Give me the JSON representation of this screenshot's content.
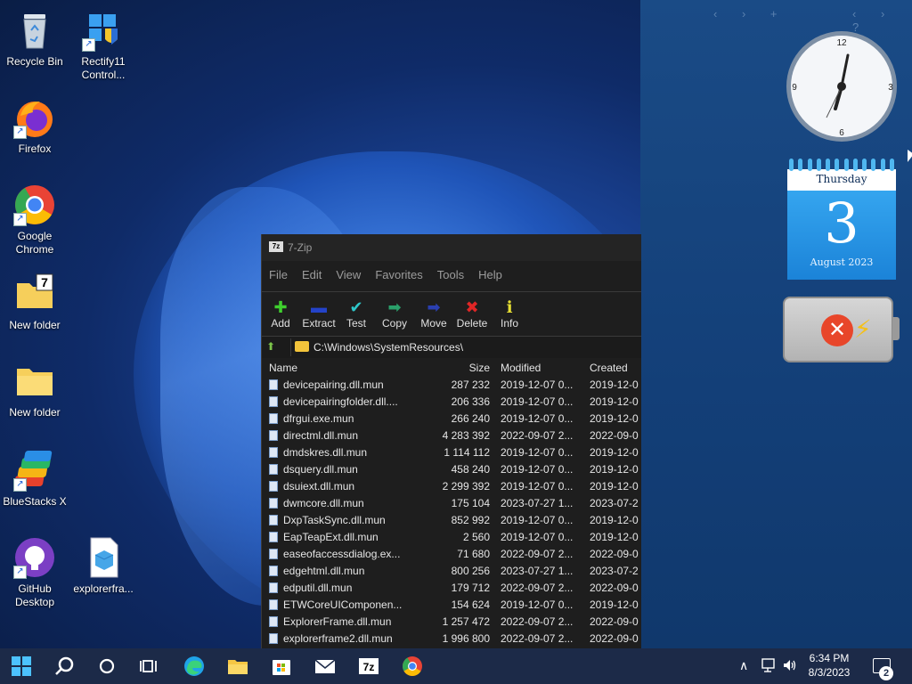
{
  "desktop": {
    "icons": [
      {
        "label": "Recycle Bin"
      },
      {
        "label": "Rectify11 Control..."
      },
      {
        "label": "Firefox"
      },
      {
        "label": "Google Chrome"
      },
      {
        "label": "New folder"
      },
      {
        "label": "New folder"
      },
      {
        "label": "BlueStacks X"
      },
      {
        "label": "GitHub Desktop"
      },
      {
        "label": "explorerfra..."
      }
    ]
  },
  "widgets": {
    "clock": {
      "n12": "12",
      "n3": "3",
      "n6": "6",
      "n9": "9"
    },
    "calendar": {
      "weekday": "Thursday",
      "day": "3",
      "month_year": "August 2023"
    }
  },
  "zip_window": {
    "title": "7-Zip",
    "menu": [
      "File",
      "Edit",
      "View",
      "Favorites",
      "Tools",
      "Help"
    ],
    "toolbar": [
      {
        "label": "Add",
        "icon": "plus-icon",
        "color": "#3fcf2e"
      },
      {
        "label": "Extract",
        "icon": "minus-icon",
        "color": "#2443c9"
      },
      {
        "label": "Test",
        "icon": "check-icon",
        "color": "#2ec6c9"
      },
      {
        "label": "Copy",
        "icon": "copy-arrow-icon",
        "color": "#2aa06a"
      },
      {
        "label": "Move",
        "icon": "move-arrow-icon",
        "color": "#2a3fb0"
      },
      {
        "label": "Delete",
        "icon": "delete-x-icon",
        "color": "#e02626"
      },
      {
        "label": "Info",
        "icon": "info-icon",
        "color": "#e8e033"
      }
    ],
    "path": "C:\\Windows\\SystemResources\\",
    "columns": {
      "name": "Name",
      "size": "Size",
      "modified": "Modified",
      "created": "Created"
    },
    "files": [
      {
        "name": "devicepairing.dll.mun",
        "size": "287 232",
        "modified": "2019-12-07 0...",
        "created": "2019-12-0"
      },
      {
        "name": "devicepairingfolder.dll....",
        "size": "206 336",
        "modified": "2019-12-07 0...",
        "created": "2019-12-0"
      },
      {
        "name": "dfrgui.exe.mun",
        "size": "266 240",
        "modified": "2019-12-07 0...",
        "created": "2019-12-0"
      },
      {
        "name": "directml.dll.mun",
        "size": "4 283 392",
        "modified": "2022-09-07 2...",
        "created": "2022-09-0"
      },
      {
        "name": "dmdskres.dll.mun",
        "size": "1 114 112",
        "modified": "2019-12-07 0...",
        "created": "2019-12-0"
      },
      {
        "name": "dsquery.dll.mun",
        "size": "458 240",
        "modified": "2019-12-07 0...",
        "created": "2019-12-0"
      },
      {
        "name": "dsuiext.dll.mun",
        "size": "2 299 392",
        "modified": "2019-12-07 0...",
        "created": "2019-12-0"
      },
      {
        "name": "dwmcore.dll.mun",
        "size": "175 104",
        "modified": "2023-07-27 1...",
        "created": "2023-07-2"
      },
      {
        "name": "DxpTaskSync.dll.mun",
        "size": "852 992",
        "modified": "2019-12-07 0...",
        "created": "2019-12-0"
      },
      {
        "name": "EapTeapExt.dll.mun",
        "size": "2 560",
        "modified": "2019-12-07 0...",
        "created": "2019-12-0"
      },
      {
        "name": "easeofaccessdialog.ex...",
        "size": "71 680",
        "modified": "2022-09-07 2...",
        "created": "2022-09-0"
      },
      {
        "name": "edgehtml.dll.mun",
        "size": "800 256",
        "modified": "2023-07-27 1...",
        "created": "2023-07-2"
      },
      {
        "name": "edputil.dll.mun",
        "size": "179 712",
        "modified": "2022-09-07 2...",
        "created": "2022-09-0"
      },
      {
        "name": "ETWCoreUIComponen...",
        "size": "154 624",
        "modified": "2019-12-07 0...",
        "created": "2019-12-0"
      },
      {
        "name": "ExplorerFrame.dll.mun",
        "size": "1 257 472",
        "modified": "2022-09-07 2...",
        "created": "2022-09-0"
      },
      {
        "name": "explorerframe2.dll.mun",
        "size": "1 996 800",
        "modified": "2022-09-07 2...",
        "created": "2022-09-0"
      }
    ]
  },
  "taskbar": {
    "clock_time": "6:34 PM",
    "clock_date": "8/3/2023",
    "zip_label": "7z",
    "notification_count": "2",
    "apps": [
      "start-icon",
      "search-icon",
      "cortana-icon",
      "task-view-icon",
      "edge-icon",
      "file-explorer-icon",
      "store-icon",
      "mail-icon",
      "7zip-icon",
      "chrome-icon"
    ]
  },
  "colors": {
    "taskbar": "#1c2a48",
    "window_bg": "#1e1e1e",
    "accent": "#1b83d8"
  }
}
